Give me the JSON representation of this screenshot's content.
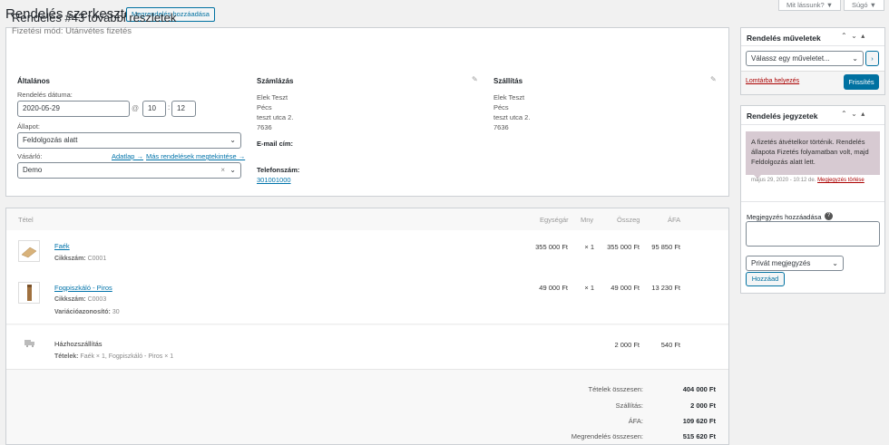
{
  "header": {
    "title": "Rendelés szerkesztése",
    "add_button": "Megrendelés hozzáadása",
    "screen_options": "Mit lássunk? ▼",
    "help": "Súgó ▼"
  },
  "order": {
    "title": "Rendelés #43 további részletek",
    "payment": "Fizetési mód: Utánvétes fizetés",
    "general": {
      "heading": "Általános",
      "date_label": "Rendelés dátuma:",
      "date_value": "2020-05-29",
      "hour": "10",
      "minute": "12",
      "status_label": "Állapot:",
      "status_value": "Feldolgozás alatt",
      "customer_label": "Vásárló:",
      "profile_link": "Adatlap →",
      "other_orders_link": "Más rendelések megtekintése →",
      "customer_value": "Demo"
    },
    "billing": {
      "heading": "Számlázás",
      "lines": [
        "Elek Teszt",
        "Pécs",
        "teszt utca 2.",
        "7636"
      ],
      "email_label": "E-mail cím:",
      "phone_label": "Telefonszám:",
      "phone_value": "301001000"
    },
    "shipping": {
      "heading": "Szállítás",
      "lines": [
        "Elek Teszt",
        "Pécs",
        "teszt utca 2.",
        "7636"
      ]
    }
  },
  "items": {
    "headers": {
      "item": "Tétel",
      "cost": "Egységár",
      "qty": "Mny",
      "total": "Összeg",
      "tax": "ÁFA"
    },
    "rows": [
      {
        "name": "Faék",
        "sku": "Cikkszám:",
        "sku_value": "C0001",
        "cost": "355 000 Ft",
        "qty": "× 1",
        "total": "355 000 Ft",
        "tax": "95 850 Ft"
      },
      {
        "name": "Fogpiszkáló - Piros",
        "sku": "Cikkszám:",
        "sku_value": "C0003",
        "variation": "Variációazonosító:",
        "variation_value": "30",
        "cost": "49 000 Ft",
        "qty": "× 1",
        "total": "49 000 Ft",
        "tax": "13 230 Ft"
      }
    ],
    "shipping_row": {
      "name": "Házhozszállítás",
      "items_label": "Tételek:",
      "items_value": "Faék × 1, Fogpiszkáló - Piros × 1",
      "total": "2 000 Ft",
      "tax": "540 Ft"
    },
    "totals": [
      {
        "label": "Tételek összesen:",
        "value": "404 000 Ft"
      },
      {
        "label": "Szállítás:",
        "value": "2 000 Ft"
      },
      {
        "label": "ÁFA:",
        "value": "109 620 Ft"
      },
      {
        "label": "Megrendelés összesen:",
        "value": "515 620 Ft"
      }
    ]
  },
  "actions": {
    "title": "Rendelés műveletek",
    "select_placeholder": "Válassz egy műveletet...",
    "go": "›",
    "trash_link": "Lomtárba helyezés",
    "update_button": "Frissítés"
  },
  "notes": {
    "title": "Rendelés jegyzetek",
    "note_text": "A fizetés átvételkor történik. Rendelés állapota Fizetés folyamatban volt, majd Feldolgozás alatt lett.",
    "note_date": "május 29, 2020 - 10:12 de.",
    "delete_link": "Megjegyzés törlése",
    "add_label": "Megjegyzés hozzáadása",
    "type_value": "Privát megjegyzés",
    "add_button": "Hozzáad"
  }
}
